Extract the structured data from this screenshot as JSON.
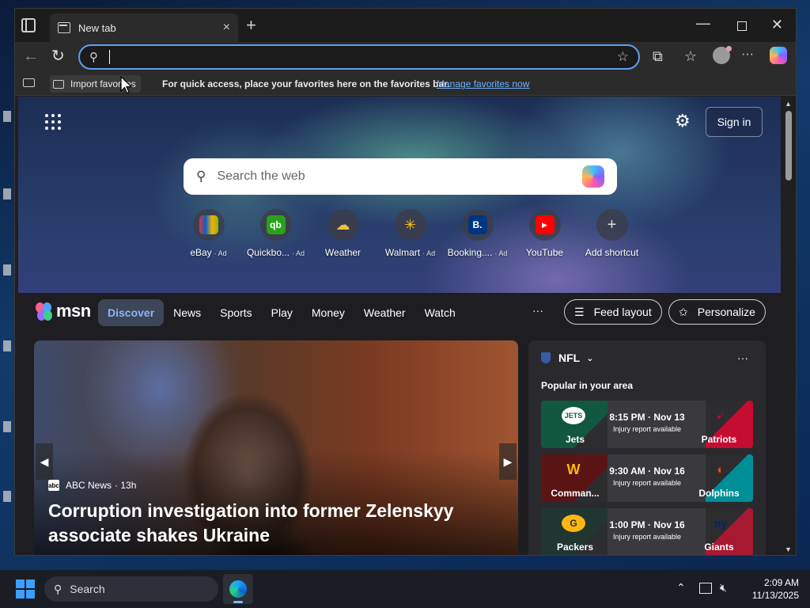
{
  "browser": {
    "tab_title": "New tab",
    "tab_close": "×",
    "new_tab": "+",
    "window_controls": {
      "minimize": "—",
      "close": "✕"
    },
    "address_placeholder": "",
    "favorites_bar": {
      "import_label": "Import favorites",
      "message": "For quick access, place your favorites here on the favorites bar.",
      "manage_link": "Manage favorites now"
    }
  },
  "page": {
    "signin_label": "Sign in",
    "search_placeholder": "Search the web",
    "shortcuts": [
      {
        "label": "eBay",
        "ad": "· Ad",
        "icon": "ebay-icon",
        "color": "#e53238"
      },
      {
        "label": "Quickbo...",
        "ad": "· Ad",
        "icon": "quickbooks-icon",
        "color": "#2ca01c"
      },
      {
        "label": "Weather",
        "ad": "",
        "icon": "weather-icon",
        "color": "#f0c040"
      },
      {
        "label": "Walmart",
        "ad": "· Ad",
        "icon": "walmart-icon",
        "color": "#0071ce"
      },
      {
        "label": "Booking....",
        "ad": "· Ad",
        "icon": "booking-icon",
        "color": "#003580"
      },
      {
        "label": "YouTube",
        "ad": "",
        "icon": "youtube-icon",
        "color": "#ff0000"
      },
      {
        "label": "Add shortcut",
        "ad": "",
        "icon": "plus-icon",
        "color": "#555555"
      }
    ]
  },
  "msn": {
    "logo_text": "msn",
    "nav": [
      "Discover",
      "News",
      "Sports",
      "Play",
      "Money",
      "Weather",
      "Watch"
    ],
    "more": "···",
    "feed_layout": "Feed layout",
    "personalize": "Personalize",
    "hero": {
      "source": "ABC News",
      "time": "· 13h",
      "title": "Corruption investigation into former Zelenskyy associate shakes Ukraine"
    },
    "nfl": {
      "title": "NFL",
      "subtitle": "Popular in your area",
      "more": "···",
      "games": [
        {
          "home": "Jets",
          "away": "Patriots",
          "time": "8:15 PM · Nov 13",
          "note": "Injury report available",
          "home_color": "#125740",
          "away_color": "#c60c30"
        },
        {
          "home": "Comman...",
          "away": "Dolphins",
          "time": "9:30 AM · Nov 16",
          "note": "Injury report available",
          "home_color": "#5a1414",
          "away_color": "#008e97"
        },
        {
          "home": "Packers",
          "away": "Giants",
          "time": "1:00 PM · Nov 16",
          "note": "Injury report available",
          "home_color": "#203731",
          "away_color": "#a71930"
        }
      ]
    }
  },
  "taskbar": {
    "search_label": "Search",
    "time": "2:09 AM",
    "date": "11/13/2025"
  }
}
